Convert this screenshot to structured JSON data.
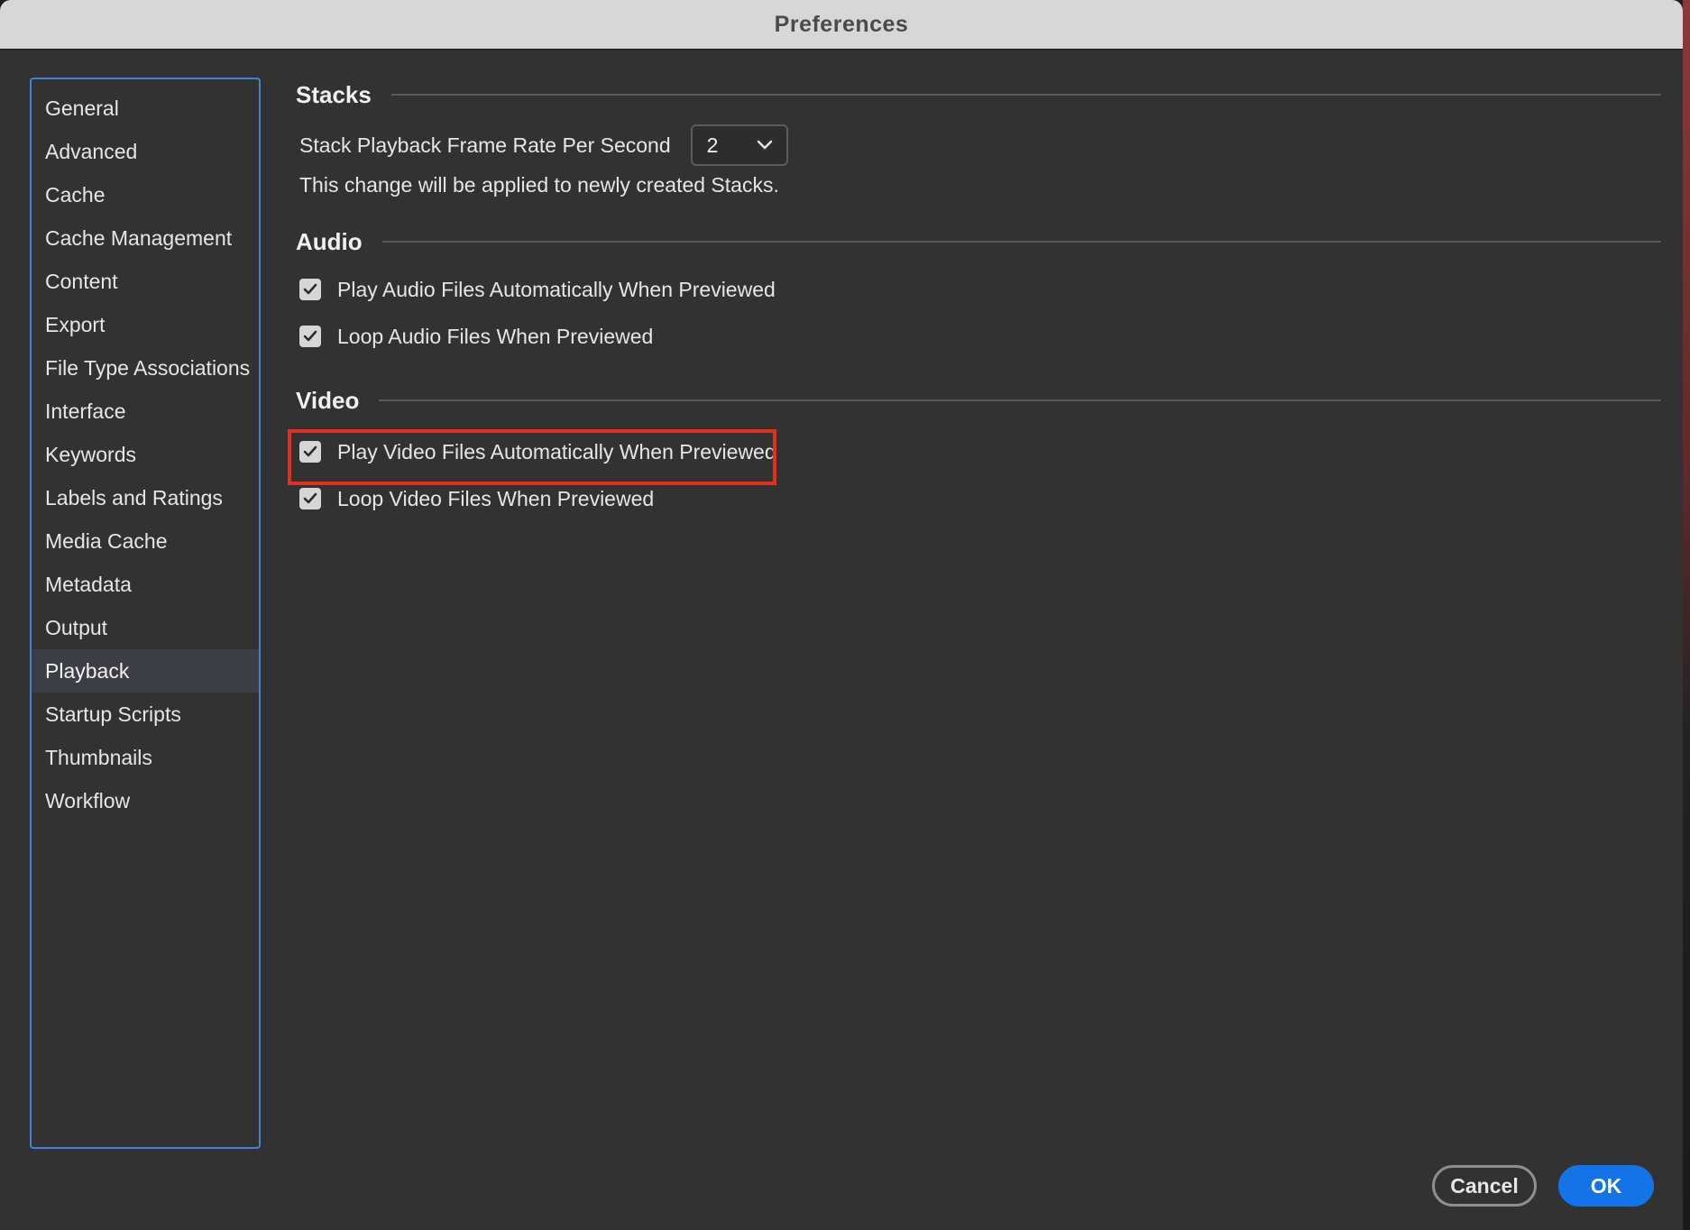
{
  "window": {
    "title": "Preferences"
  },
  "sidebar": {
    "items": [
      {
        "label": "General"
      },
      {
        "label": "Advanced"
      },
      {
        "label": "Cache"
      },
      {
        "label": "Cache Management"
      },
      {
        "label": "Content"
      },
      {
        "label": "Export"
      },
      {
        "label": "File Type Associations"
      },
      {
        "label": "Interface"
      },
      {
        "label": "Keywords"
      },
      {
        "label": "Labels and Ratings"
      },
      {
        "label": "Media Cache"
      },
      {
        "label": "Metadata"
      },
      {
        "label": "Output"
      },
      {
        "label": "Playback"
      },
      {
        "label": "Startup Scripts"
      },
      {
        "label": "Thumbnails"
      },
      {
        "label": "Workflow"
      }
    ],
    "selected": "Playback"
  },
  "stacks": {
    "title": "Stacks",
    "frame_rate_label": "Stack Playback Frame Rate Per Second",
    "frame_rate_value": "2",
    "note": "This change will be applied to newly created Stacks."
  },
  "audio": {
    "title": "Audio",
    "options": [
      {
        "label": "Play Audio Files Automatically When Previewed",
        "checked": true
      },
      {
        "label": "Loop Audio Files When Previewed",
        "checked": true
      }
    ]
  },
  "video": {
    "title": "Video",
    "options": [
      {
        "label": "Play Video Files Automatically When Previewed",
        "checked": true
      },
      {
        "label": "Loop Video Files When Previewed",
        "checked": true
      }
    ]
  },
  "buttons": {
    "cancel": "Cancel",
    "ok": "OK"
  },
  "colors": {
    "accent": "#1473e6",
    "sidebar_border": "#3d83d8",
    "highlight": "#e0301e",
    "panel_bg": "#323232"
  },
  "icons": {
    "dropdown": "chevron-down-icon",
    "checkbox": "checkmark-icon"
  }
}
